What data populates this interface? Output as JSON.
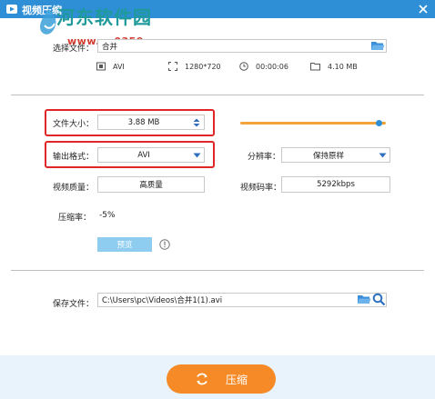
{
  "window": {
    "title": "视频压缩"
  },
  "watermark": {
    "site_name": "河东软件园",
    "url": "www.pc0359.cn"
  },
  "source": {
    "label": "选择文件：",
    "value": "合并",
    "format": "AVI",
    "resolution": "1280*720",
    "duration": "00:00:06",
    "size": "4.10 MB"
  },
  "settings": {
    "file_size_label": "文件大小：",
    "file_size_value": "3.88 MB",
    "file_size_fraction": 0.95,
    "output_format_label": "输出格式：",
    "output_format_value": "AVI",
    "resolution_label": "分辨率：",
    "resolution_value": "保持原样",
    "quality_label": "视频质量：",
    "quality_value": "高质量",
    "bitrate_label": "视频码率：",
    "bitrate_value": "5292kbps",
    "compression_label": "压缩率：",
    "compression_value": "-5%",
    "preview_label": "预览"
  },
  "save": {
    "label": "保存文件：",
    "path": "C:\\Users\\pc\\Videos\\合并1(1).avi"
  },
  "footer": {
    "compress_label": "压缩"
  },
  "colors": {
    "titlebar": "#2f8fd6",
    "accent_orange": "#f58a26",
    "slider": "#f2a33a",
    "highlight_red": "#e02626",
    "folder_blue": "#3a8fd8"
  }
}
